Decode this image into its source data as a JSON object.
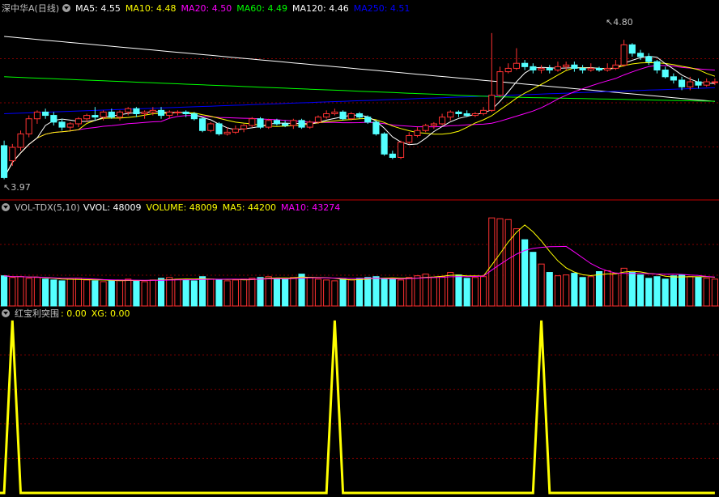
{
  "main_panel": {
    "title": "深中华A(日线)",
    "indicators": [
      {
        "label": "MA5: 4.55",
        "color": "#ffffff"
      },
      {
        "label": "MA10: 4.48",
        "color": "#ffff00"
      },
      {
        "label": "MA20: 4.50",
        "color": "#ff00ff"
      },
      {
        "label": "MA60: 4.49",
        "color": "#00ff00"
      },
      {
        "label": "MA120: 4.46",
        "color": "#ffffff"
      },
      {
        "label": "MA250: 4.51",
        "color": "#0000ff"
      }
    ],
    "high_label": "4.80",
    "low_label": "3.97"
  },
  "volume_panel": {
    "title": "VOL-TDX(5,10)",
    "indicators": [
      {
        "label": "VVOL: 48009",
        "color": "#ffffff"
      },
      {
        "label": "VOLUME: 48009",
        "color": "#ffff00"
      },
      {
        "label": "MA5: 44200",
        "color": "#ffff00"
      },
      {
        "label": "MA10: 43274",
        "color": "#ff00ff"
      }
    ]
  },
  "signal_panel": {
    "title": "红宝利突围",
    "indicators": [
      {
        "label": ": 0.00",
        "color": "#ffff00"
      },
      {
        "label": "XG: 0.00",
        "color": "#ffff00"
      }
    ]
  },
  "colors": {
    "up": "#ff3232",
    "down": "#54ffff",
    "grid": "#800000",
    "signal": "#ffff00"
  },
  "chart_data": {
    "type": "candlestick",
    "price_range": [
      3.9,
      4.95
    ],
    "candles": [
      [
        4.17,
        3.98,
        4.2,
        3.97
      ],
      [
        4.08,
        4.16,
        4.18,
        4.05
      ],
      [
        4.16,
        4.24,
        4.26,
        4.14
      ],
      [
        4.24,
        4.33,
        4.35,
        4.22
      ],
      [
        4.33,
        4.37,
        4.38,
        4.3
      ],
      [
        4.37,
        4.35,
        4.39,
        4.33
      ],
      [
        4.35,
        4.31,
        4.37,
        4.29
      ],
      [
        4.31,
        4.28,
        4.33,
        4.26
      ],
      [
        4.28,
        4.3,
        4.31,
        4.26
      ],
      [
        4.3,
        4.33,
        4.34,
        4.28
      ],
      [
        4.33,
        4.35,
        4.36,
        4.31
      ],
      [
        4.35,
        4.34,
        4.4,
        4.32
      ],
      [
        4.34,
        4.37,
        4.38,
        4.32
      ],
      [
        4.37,
        4.34,
        4.39,
        4.33
      ],
      [
        4.34,
        4.37,
        4.38,
        4.32
      ],
      [
        4.37,
        4.39,
        4.4,
        4.35
      ],
      [
        4.39,
        4.36,
        4.4,
        4.34
      ],
      [
        4.36,
        4.37,
        4.38,
        4.33
      ],
      [
        4.37,
        4.38,
        4.4,
        4.35
      ],
      [
        4.38,
        4.35,
        4.4,
        4.33
      ],
      [
        4.35,
        4.37,
        4.38,
        4.33
      ],
      [
        4.37,
        4.37,
        4.38,
        4.35
      ],
      [
        4.37,
        4.36,
        4.38,
        4.34
      ],
      [
        4.36,
        4.33,
        4.37,
        4.32
      ],
      [
        4.33,
        4.26,
        4.34,
        4.25
      ],
      [
        4.26,
        4.3,
        4.31,
        4.25
      ],
      [
        4.3,
        4.24,
        4.31,
        4.23
      ],
      [
        4.24,
        4.25,
        4.28,
        4.23
      ],
      [
        4.25,
        4.27,
        4.29,
        4.24
      ],
      [
        4.27,
        4.29,
        4.3,
        4.25
      ],
      [
        4.29,
        4.33,
        4.34,
        4.28
      ],
      [
        4.33,
        4.28,
        4.34,
        4.27
      ],
      [
        4.28,
        4.32,
        4.33,
        4.27
      ],
      [
        4.32,
        4.3,
        4.33,
        4.29
      ],
      [
        4.3,
        4.29,
        4.32,
        4.28
      ],
      [
        4.29,
        4.32,
        4.33,
        4.27
      ],
      [
        4.32,
        4.28,
        4.33,
        4.27
      ],
      [
        4.28,
        4.31,
        4.32,
        4.27
      ],
      [
        4.31,
        4.34,
        4.35,
        4.3
      ],
      [
        4.34,
        4.36,
        4.38,
        4.33
      ],
      [
        4.36,
        4.37,
        4.39,
        4.35
      ],
      [
        4.37,
        4.33,
        4.38,
        4.32
      ],
      [
        4.33,
        4.36,
        4.37,
        4.32
      ],
      [
        4.36,
        4.34,
        4.37,
        4.33
      ],
      [
        4.34,
        4.31,
        4.35,
        4.3
      ],
      [
        4.31,
        4.24,
        4.32,
        4.23
      ],
      [
        4.24,
        4.12,
        4.25,
        4.11
      ],
      [
        4.12,
        4.1,
        4.14,
        4.09
      ],
      [
        4.1,
        4.19,
        4.2,
        4.09
      ],
      [
        4.19,
        4.23,
        4.25,
        4.18
      ],
      [
        4.23,
        4.26,
        4.28,
        4.22
      ],
      [
        4.26,
        4.29,
        4.3,
        4.25
      ],
      [
        4.29,
        4.3,
        4.31,
        4.27
      ],
      [
        4.3,
        4.34,
        4.36,
        4.29
      ],
      [
        4.34,
        4.37,
        4.38,
        4.32
      ],
      [
        4.37,
        4.36,
        4.38,
        4.34
      ],
      [
        4.36,
        4.35,
        4.38,
        4.34
      ],
      [
        4.35,
        4.36,
        4.37,
        4.34
      ],
      [
        4.36,
        4.38,
        4.4,
        4.35
      ],
      [
        4.38,
        4.47,
        4.84,
        4.37
      ],
      [
        4.47,
        4.61,
        4.64,
        4.46
      ],
      [
        4.61,
        4.63,
        4.66,
        4.6
      ],
      [
        4.63,
        4.66,
        4.75,
        4.62
      ],
      [
        4.66,
        4.64,
        4.68,
        4.62
      ],
      [
        4.64,
        4.62,
        4.66,
        4.6
      ],
      [
        4.62,
        4.63,
        4.65,
        4.6
      ],
      [
        4.63,
        4.62,
        4.65,
        4.6
      ],
      [
        4.62,
        4.64,
        4.67,
        4.61
      ],
      [
        4.64,
        4.65,
        4.67,
        4.62
      ],
      [
        4.65,
        4.63,
        4.67,
        4.61
      ],
      [
        4.63,
        4.62,
        4.65,
        4.6
      ],
      [
        4.62,
        4.63,
        4.66,
        4.61
      ],
      [
        4.63,
        4.62,
        4.64,
        4.61
      ],
      [
        4.62,
        4.63,
        4.66,
        4.61
      ],
      [
        4.63,
        4.65,
        4.68,
        4.62
      ],
      [
        4.65,
        4.77,
        4.8,
        4.64
      ],
      [
        4.77,
        4.72,
        4.78,
        4.7
      ],
      [
        4.72,
        4.7,
        4.74,
        4.68
      ],
      [
        4.7,
        4.67,
        4.72,
        4.65
      ],
      [
        4.67,
        4.62,
        4.68,
        4.6
      ],
      [
        4.62,
        4.58,
        4.64,
        4.57
      ],
      [
        4.58,
        4.56,
        4.6,
        4.54
      ],
      [
        4.56,
        4.52,
        4.58,
        4.5
      ],
      [
        4.52,
        4.55,
        4.58,
        4.5
      ],
      [
        4.55,
        4.53,
        4.57,
        4.51
      ],
      [
        4.53,
        4.55,
        4.57,
        4.52
      ],
      [
        4.55,
        4.55,
        4.57,
        4.53
      ]
    ],
    "volume_range": [
      0,
      110000
    ],
    "volumes": [
      36000,
      34000,
      35000,
      33000,
      34000,
      32000,
      31000,
      30000,
      32000,
      33000,
      31000,
      30000,
      29000,
      30000,
      31000,
      32000,
      30000,
      29000,
      31000,
      33000,
      34000,
      32000,
      31000,
      30000,
      35000,
      32000,
      31000,
      30000,
      31000,
      32000,
      33000,
      34000,
      35000,
      33000,
      32000,
      34000,
      38000,
      34000,
      32000,
      31000,
      30000,
      32000,
      31000,
      33000,
      34000,
      35000,
      33000,
      32000,
      31000,
      34000,
      36000,
      38000,
      34000,
      35000,
      40000,
      37000,
      33000,
      34000,
      35000,
      105000,
      104000,
      103000,
      92000,
      79000,
      64000,
      50000,
      40000,
      36000,
      37000,
      39000,
      34000,
      35000,
      41000,
      42000,
      39000,
      45000,
      40000,
      37000,
      33000,
      35000,
      32000,
      36000,
      37000,
      35000,
      34000,
      33000,
      32000
    ],
    "signal_range": [
      0,
      1
    ],
    "signal_spikes": [
      1,
      40,
      65
    ]
  }
}
